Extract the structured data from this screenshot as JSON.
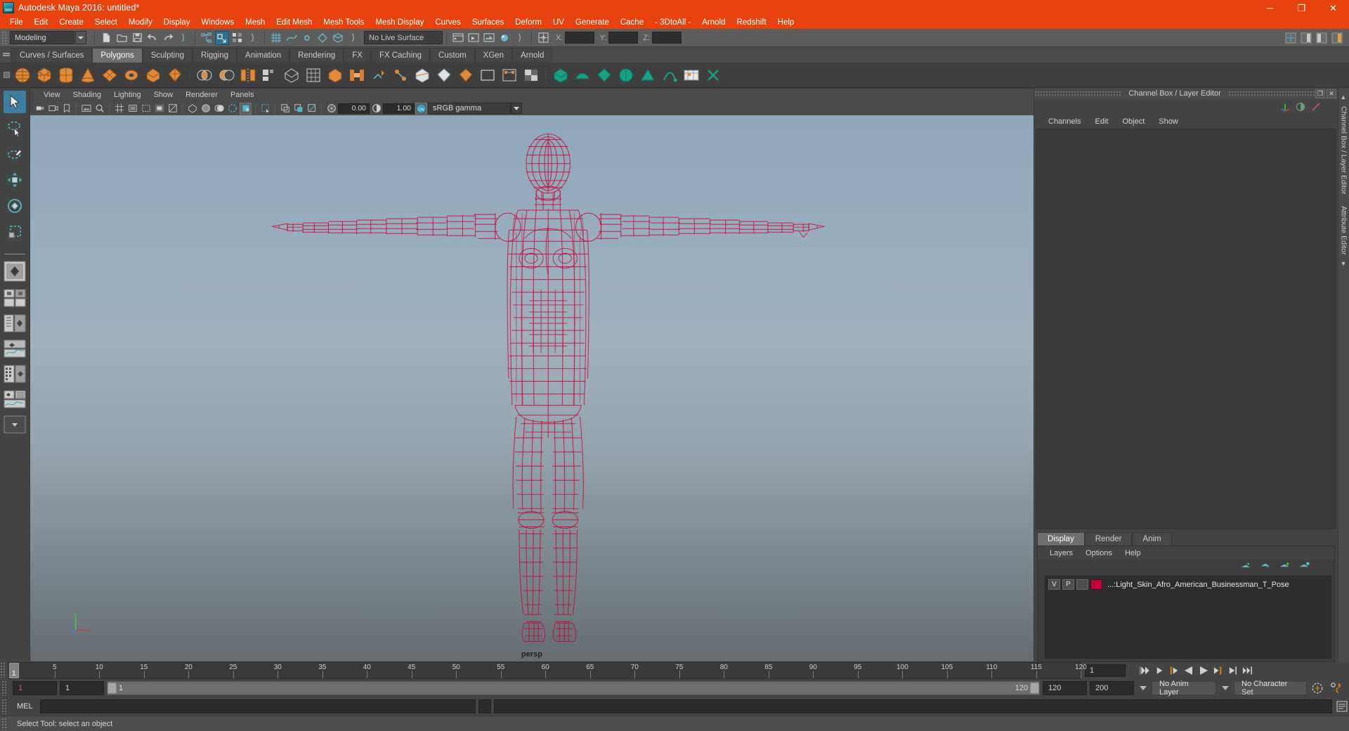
{
  "window": {
    "title": "Autodesk Maya 2016: untitled*",
    "app_icon": "maya-logo-icon",
    "minimize_label": "─",
    "maximize_label": "❐",
    "close_label": "✕",
    "titlebar_color": "#e8430f"
  },
  "menubar": {
    "items": [
      {
        "label": "File"
      },
      {
        "label": "Edit"
      },
      {
        "label": "Create"
      },
      {
        "label": "Select"
      },
      {
        "label": "Modify"
      },
      {
        "label": "Display"
      },
      {
        "label": "Windows"
      },
      {
        "label": "Mesh"
      },
      {
        "label": "Edit Mesh"
      },
      {
        "label": "Mesh Tools"
      },
      {
        "label": "Mesh Display"
      },
      {
        "label": "Curves"
      },
      {
        "label": "Surfaces"
      },
      {
        "label": "Deform"
      },
      {
        "label": "UV"
      },
      {
        "label": "Generate"
      },
      {
        "label": "Cache"
      },
      {
        "label": "- 3DtoAll -"
      },
      {
        "label": "Arnold"
      },
      {
        "label": "Redshift"
      },
      {
        "label": "Help"
      }
    ]
  },
  "statusline": {
    "mode_menu": "Modeling",
    "live_surface": "No Live Surface",
    "coord_x_label": "X:",
    "coord_y_label": "Y:",
    "coord_z_label": "Z:",
    "coord_x_value": "",
    "coord_y_value": "",
    "coord_z_value": ""
  },
  "shelf": {
    "tabs": [
      {
        "label": "Curves / Surfaces",
        "active": false
      },
      {
        "label": "Polygons",
        "active": true
      },
      {
        "label": "Sculpting",
        "active": false
      },
      {
        "label": "Rigging",
        "active": false
      },
      {
        "label": "Animation",
        "active": false
      },
      {
        "label": "Rendering",
        "active": false
      },
      {
        "label": "FX",
        "active": false
      },
      {
        "label": "FX Caching",
        "active": false
      },
      {
        "label": "Custom",
        "active": false
      },
      {
        "label": "XGen",
        "active": false
      },
      {
        "label": "Arnold",
        "active": false
      }
    ]
  },
  "viewport": {
    "menu": [
      {
        "label": "View"
      },
      {
        "label": "Shading"
      },
      {
        "label": "Lighting"
      },
      {
        "label": "Show"
      },
      {
        "label": "Renderer"
      },
      {
        "label": "Panels"
      }
    ],
    "exposure_value": "0.00",
    "gamma_value": "1.00",
    "color_management": "sRGB gamma",
    "camera_label": "persp",
    "wireframe_color": "#cc0033",
    "model_name": "Light_Skin_Afro_American_Businessman_T_Pose"
  },
  "channel_box": {
    "panel_title": "Channel Box / Layer Editor",
    "menu": [
      {
        "label": "Channels"
      },
      {
        "label": "Edit"
      },
      {
        "label": "Object"
      },
      {
        "label": "Show"
      }
    ],
    "float_button": "❐",
    "close_button": "✕"
  },
  "layer_editor": {
    "tabs": [
      {
        "label": "Display",
        "active": true
      },
      {
        "label": "Render",
        "active": false
      },
      {
        "label": "Anim",
        "active": false
      }
    ],
    "menu": [
      {
        "label": "Layers"
      },
      {
        "label": "Options"
      },
      {
        "label": "Help"
      }
    ],
    "layers": [
      {
        "visibility": "V",
        "playback": "P",
        "shading": "",
        "color": "#c4003c",
        "name": "...:Light_Skin_Afro_American_Businessman_T_Pose"
      }
    ]
  },
  "side_tabs": [
    {
      "label": "Channel Box / Layer Editor"
    },
    {
      "label": "Attribute Editor"
    }
  ],
  "timeline": {
    "ticks": [
      5,
      10,
      15,
      20,
      25,
      30,
      35,
      40,
      45,
      50,
      55,
      60,
      65,
      70,
      75,
      80,
      85,
      90,
      95,
      100,
      105,
      110,
      115,
      120
    ],
    "start": 1,
    "end": 120,
    "current_frame": "1",
    "current_frame_marker": "1",
    "playback_buttons": [
      {
        "name": "go-to-start-icon"
      },
      {
        "name": "step-back-keyframe-icon"
      },
      {
        "name": "step-back-frame-icon"
      },
      {
        "name": "play-backwards-icon"
      },
      {
        "name": "play-forwards-icon"
      },
      {
        "name": "step-forward-frame-icon"
      },
      {
        "name": "step-forward-keyframe-icon"
      },
      {
        "name": "go-to-end-icon"
      }
    ]
  },
  "range_slider": {
    "anim_start": "1",
    "playback_start": "1",
    "slider_start_label": "1",
    "slider_end_label": "120",
    "playback_end": "120",
    "anim_end": "200",
    "anim_layer": "No Anim Layer",
    "character_set": "No Character Set"
  },
  "command_line": {
    "language_label": "MEL",
    "input_value": "",
    "input_placeholder": ""
  },
  "status_bar": {
    "message": "Select Tool: select an object"
  },
  "toolbox": {
    "items": [
      {
        "name": "select-tool",
        "active": true
      },
      {
        "name": "lasso-select-tool",
        "active": false
      },
      {
        "name": "paint-select-tool",
        "active": false
      },
      {
        "name": "move-tool",
        "active": false
      },
      {
        "name": "rotate-tool",
        "active": false
      },
      {
        "name": "scale-tool",
        "active": false
      }
    ],
    "layout_items": [
      {
        "name": "single-perspective-view-layout"
      },
      {
        "name": "four-view-layout"
      },
      {
        "name": "outliner-persp-layout"
      },
      {
        "name": "persp-graph-editor-layout"
      },
      {
        "name": "hypershade-persp-layout"
      },
      {
        "name": "persp-graph-outliner-layout"
      },
      {
        "name": "more-layouts"
      }
    ]
  },
  "chart_data": null
}
